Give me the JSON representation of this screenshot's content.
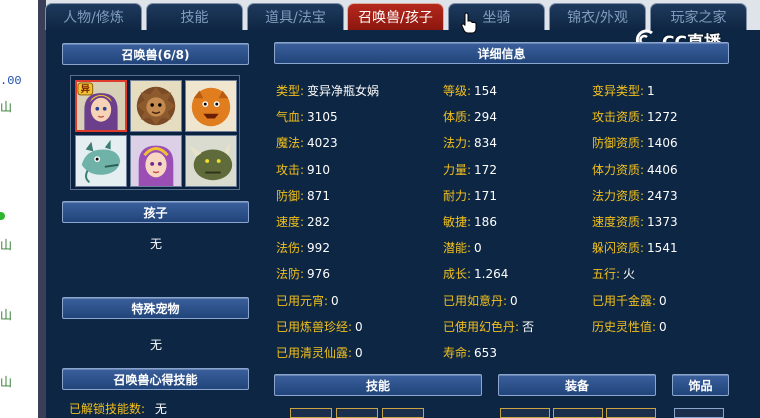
{
  "left_fragments": [
    {
      "text": ".00",
      "color": "#1d4fb0"
    },
    {
      "text": "山",
      "color": "#2f7a2f"
    },
    {
      "text": "山",
      "color": "#2f7a2f"
    },
    {
      "text": "山",
      "color": "#2f7a2f"
    },
    {
      "text": "山",
      "color": "#2f7a2f"
    }
  ],
  "tabs": [
    {
      "label": "人物/修炼"
    },
    {
      "label": "技能"
    },
    {
      "label": "道具/法宝"
    },
    {
      "label": "召唤兽/孩子"
    },
    {
      "label": "坐骑"
    },
    {
      "label": "锦衣/外观"
    },
    {
      "label": "玩家之家"
    }
  ],
  "watermark": {
    "text": "CC直播",
    "icon": "cc-logo-icon"
  },
  "pets_header": "召唤兽(6/8)",
  "pet_icons": [
    "pet-girl-horn-icon",
    "pet-lion-icon",
    "pet-orange-beast-icon",
    "pet-dragon-icon",
    "pet-girl-purple-icon",
    "pet-rhino-icon"
  ],
  "pet_badge": "异",
  "child_header": "孩子",
  "child_value": "无",
  "special_header": "特殊宠物",
  "special_value": "无",
  "skill_header": "召唤兽心得技能",
  "unlocked": {
    "label": "已解锁技能数:",
    "value": "无"
  },
  "detail_header": "详细信息",
  "details": [
    [
      {
        "label": "类型:",
        "value": "变异净瓶女娲"
      },
      {
        "label": "等级:",
        "value": "154"
      },
      {
        "label": "变异类型:",
        "value": "1"
      }
    ],
    [
      {
        "label": "气血:",
        "value": "3105"
      },
      {
        "label": "体质:",
        "value": "294"
      },
      {
        "label": "攻击资质:",
        "value": "1272"
      }
    ],
    [
      {
        "label": "魔法:",
        "value": "4023"
      },
      {
        "label": "法力:",
        "value": "834"
      },
      {
        "label": "防御资质:",
        "value": "1406"
      }
    ],
    [
      {
        "label": "攻击:",
        "value": "910"
      },
      {
        "label": "力量:",
        "value": "172"
      },
      {
        "label": "体力资质:",
        "value": "4406"
      }
    ],
    [
      {
        "label": "防御:",
        "value": "871"
      },
      {
        "label": "耐力:",
        "value": "171"
      },
      {
        "label": "法力资质:",
        "value": "2473"
      }
    ],
    [
      {
        "label": "速度:",
        "value": "282"
      },
      {
        "label": "敏捷:",
        "value": "186"
      },
      {
        "label": "速度资质:",
        "value": "1373"
      }
    ],
    [
      {
        "label": "法伤:",
        "value": "992"
      },
      {
        "label": "潜能:",
        "value": "0"
      },
      {
        "label": "躲闪资质:",
        "value": "1541"
      }
    ],
    [
      {
        "label": "法防:",
        "value": "976"
      },
      {
        "label": "成长:",
        "value": "1.264"
      },
      {
        "label": "五行:",
        "value": "火"
      }
    ],
    [
      {
        "label": "已用元宵:",
        "value": "0"
      },
      {
        "label": "已用如意丹:",
        "value": "0"
      },
      {
        "label": "已用千金露:",
        "value": "0"
      }
    ],
    [
      {
        "label": "已用炼兽珍经:",
        "value": "0"
      },
      {
        "label": "已使用幻色丹:",
        "value": "否"
      },
      {
        "label": "历史灵性值:",
        "value": "0"
      }
    ],
    [
      {
        "label": "已用清灵仙露:",
        "value": "0"
      },
      {
        "label": "寿命:",
        "value": "653"
      },
      {
        "label": "",
        "value": ""
      }
    ]
  ],
  "bottom_tabs": [
    {
      "label": "技能"
    },
    {
      "label": "装备"
    },
    {
      "label": "饰品"
    }
  ]
}
